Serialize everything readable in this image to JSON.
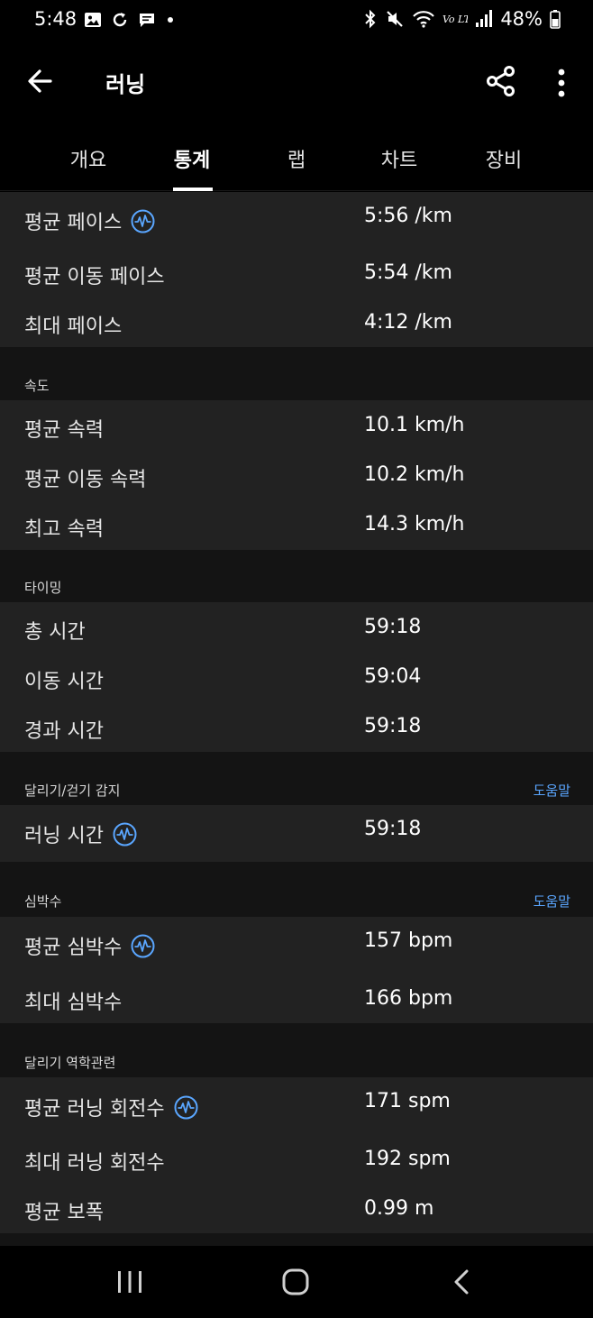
{
  "status_bar": {
    "time": "5:48",
    "left_icons": [
      "gallery-icon",
      "sync-icon",
      "message-icon",
      "dot-icon"
    ],
    "right_icons": [
      "bluetooth-icon",
      "mute-icon",
      "wifi-icon",
      "volte-icon",
      "signal-icon",
      "battery-icon"
    ],
    "volte_text": "Vo LTE",
    "battery": "48%"
  },
  "app_bar": {
    "title": "러닝"
  },
  "tabs": [
    {
      "label": "개요"
    },
    {
      "label": "통계",
      "active": true
    },
    {
      "label": "랩"
    },
    {
      "label": "차트"
    },
    {
      "label": "장비"
    }
  ],
  "pace": {
    "rows": [
      {
        "label": "평균 페이스",
        "value": "5:56 /km",
        "icon": true
      },
      {
        "label": "평균 이동 페이스",
        "value": "5:54 /km"
      },
      {
        "label": "최대 페이스",
        "value": "4:12 /km"
      }
    ]
  },
  "speed": {
    "title": "속도",
    "rows": [
      {
        "label": "평균 속력",
        "value": "10.1 km/h"
      },
      {
        "label": "평균 이동 속력",
        "value": "10.2 km/h"
      },
      {
        "label": "최고 속력",
        "value": "14.3 km/h"
      }
    ]
  },
  "timing": {
    "title": "타이밍",
    "rows": [
      {
        "label": "총 시간",
        "value": "59:18"
      },
      {
        "label": "이동 시간",
        "value": "59:04"
      },
      {
        "label": "경과 시간",
        "value": "59:18"
      }
    ]
  },
  "run_walk": {
    "title": "달리기/걷기 감지",
    "help": "도움말",
    "rows": [
      {
        "label": "러닝 시간",
        "value": "59:18",
        "icon": true
      }
    ]
  },
  "heart_rate": {
    "title": "심박수",
    "help": "도움말",
    "rows": [
      {
        "label": "평균 심박수",
        "value": "157 bpm",
        "icon": true
      },
      {
        "label": "최대 심박수",
        "value": "166 bpm"
      }
    ]
  },
  "dynamics": {
    "title": "달리기 역학관련",
    "rows": [
      {
        "label": "평균 러닝 회전수",
        "value": "171 spm",
        "icon": true
      },
      {
        "label": "최대 러닝 회전수",
        "value": "192 spm"
      },
      {
        "label": "평균 보폭",
        "value": "0.99 m"
      }
    ]
  },
  "colors": {
    "accent": "#5aa6ff",
    "card": "#222222",
    "section": "#141414",
    "background": "#000000"
  }
}
